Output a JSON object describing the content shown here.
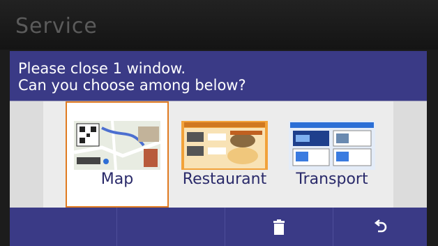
{
  "header": {
    "title": "Service"
  },
  "dialog": {
    "message_line1": "Please close 1 window.",
    "message_line2": "Can you choose among below?",
    "options": [
      {
        "label": "Map",
        "icon": "map-thumbnail",
        "selected": true
      },
      {
        "label": "Restaurant",
        "icon": "restaurant-thumbnail",
        "selected": false
      },
      {
        "label": "Transport",
        "icon": "transport-thumbnail",
        "selected": false
      }
    ]
  },
  "toolbar": {
    "buttons": [
      {
        "icon": "empty",
        "label": ""
      },
      {
        "icon": "empty",
        "label": ""
      },
      {
        "icon": "trash-icon",
        "label": ""
      },
      {
        "icon": "back-arrow-icon",
        "label": ""
      }
    ]
  },
  "colors": {
    "prompt_bg": "#3a3a86",
    "selection_border": "#e07a20",
    "label_text": "#2a2a6a"
  }
}
